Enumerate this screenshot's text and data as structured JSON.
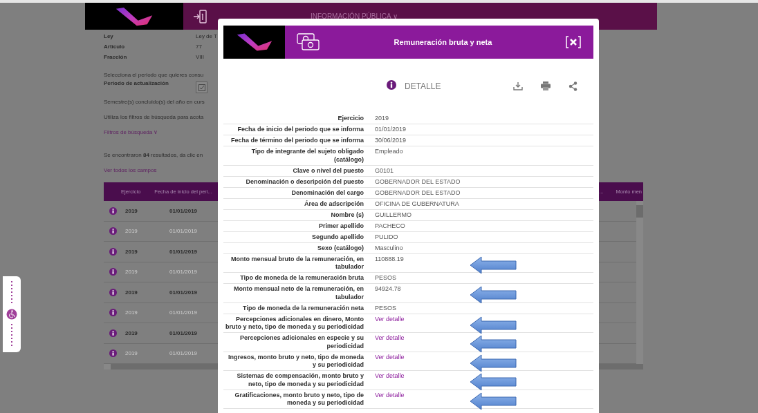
{
  "page": {
    "nav_title": "INFORMACIÓN PÚBLICA ∨",
    "info": [
      {
        "label": "Ley",
        "value": "Ley de T"
      },
      {
        "label": "Artículo",
        "value": "77"
      },
      {
        "label": "Fracción",
        "value": "VIII"
      }
    ],
    "period_prompt": "Selecciona el periodo que quieres consu",
    "period_label": "Periodo de actualización",
    "period_checked": true,
    "semester_text": "Semestre(s) concluido(s) del año en curs",
    "filter_hint": "Utiliza los filtros de búsqueda para acota",
    "filters_link": "Filtros de búsqueda ∨",
    "results_text": "Se encontraron **84** resultados, da clic en",
    "all_fields_link": "Ver todos los campos",
    "table": {
      "columns": [
        "Ejercicio",
        "Fecha de inicio del peri...",
        "...",
        "Monto men"
      ],
      "rows": [
        {
          "ejercicio": "2019",
          "fecha": "01/01/2019"
        },
        {
          "ejercicio": "2019",
          "fecha": "01/01/2019"
        },
        {
          "ejercicio": "2019",
          "fecha": "01/01/2019"
        },
        {
          "ejercicio": "2019",
          "fecha": "01/01/2019"
        },
        {
          "ejercicio": "2019",
          "fecha": "01/01/2019"
        },
        {
          "ejercicio": "2019",
          "fecha": "01/01/2019"
        },
        {
          "ejercicio": "2019",
          "fecha": "01/01/2019"
        },
        {
          "ejercicio": "2019",
          "fecha": "01/01/2019"
        }
      ]
    }
  },
  "modal": {
    "title": "Remuneración bruta y neta",
    "section": "DETALLE",
    "fields": [
      {
        "label": "Ejercicio",
        "value": "2019",
        "kind": "text",
        "annotated": false
      },
      {
        "label": "Fecha de inicio del periodo que se informa",
        "value": "01/01/2019",
        "kind": "text",
        "annotated": false
      },
      {
        "label": "Fecha de término del periodo que se informa",
        "value": "30/06/2019",
        "kind": "text",
        "annotated": false
      },
      {
        "label": "Tipo de integrante del sujeto obligado (catálogo)",
        "value": "Empleado",
        "kind": "text",
        "annotated": false
      },
      {
        "label": "Clave o nivel del puesto",
        "value": "G0101",
        "kind": "text",
        "annotated": false
      },
      {
        "label": "Denominación o descripción del puesto",
        "value": "GOBERNADOR DEL ESTADO",
        "kind": "text",
        "annotated": false
      },
      {
        "label": "Denominación del cargo",
        "value": "GOBERNADOR DEL ESTADO",
        "kind": "text",
        "annotated": false
      },
      {
        "label": "Área de adscripción",
        "value": "OFICINA DE GUBERNATURA",
        "kind": "text",
        "annotated": false
      },
      {
        "label": "Nombre (s)",
        "value": "GUILLERMO",
        "kind": "text",
        "annotated": false
      },
      {
        "label": "Primer apellido",
        "value": "PACHECO",
        "kind": "text",
        "annotated": false
      },
      {
        "label": "Segundo apellido",
        "value": "PULIDO",
        "kind": "text",
        "annotated": false
      },
      {
        "label": "Sexo (catálogo)",
        "value": "Masculino",
        "kind": "text",
        "annotated": false
      },
      {
        "label": "Monto mensual bruto de la remuneración, en tabulador",
        "value": "110888.19",
        "kind": "text",
        "annotated": true
      },
      {
        "label": "Tipo de moneda de la remuneración bruta",
        "value": "PESOS",
        "kind": "text",
        "annotated": false
      },
      {
        "label": "Monto mensual neto de la remuneración, en tabulador",
        "value": "94924.78",
        "kind": "text",
        "annotated": true
      },
      {
        "label": "Tipo de moneda de la remuneración neta",
        "value": "PESOS",
        "kind": "text",
        "annotated": false
      },
      {
        "label": "Percepciones adicionales en dinero, Monto bruto y neto, tipo de moneda y su periodicidad",
        "value": "Ver detalle",
        "kind": "link",
        "annotated": true
      },
      {
        "label": "Percepciones adicionales en especie y su periodicidad",
        "value": "Ver detalle",
        "kind": "link",
        "annotated": true
      },
      {
        "label": "Ingresos, monto bruto y neto, tipo de moneda y su periodicidad",
        "value": "Ver detalle",
        "kind": "link",
        "annotated": true
      },
      {
        "label": "Sistemas de compensación, monto bruto y neto, tipo de moneda y su periodicidad",
        "value": "Ver detalle",
        "kind": "link",
        "annotated": true
      },
      {
        "label": "Gratificaciones, monto bruto y neto, tipo de moneda y su periodicidad",
        "value": "Ver detalle",
        "kind": "link",
        "annotated": true
      }
    ]
  }
}
